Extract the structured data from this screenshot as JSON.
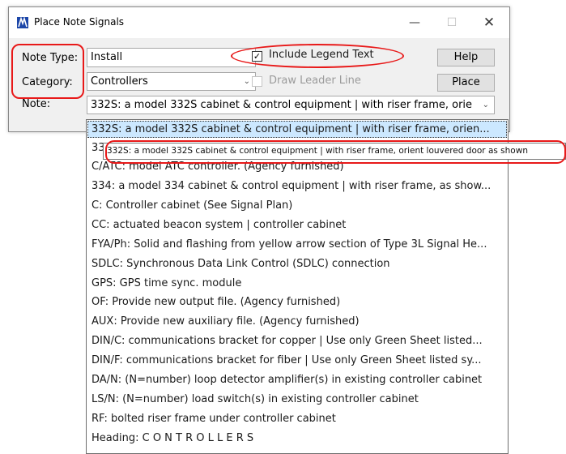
{
  "window": {
    "title": "Place Note Signals",
    "controls": {
      "minimize": "—",
      "maximize": "☐",
      "close": "✕"
    }
  },
  "form": {
    "note_type_label": "Note Type:",
    "note_type_value": "Install",
    "category_label": "Category:",
    "category_value": "Controllers",
    "note_label": "Note:",
    "note_value": "332S: a model 332S cabinet & control equipment | with riser frame, orie"
  },
  "options": {
    "include_legend_text": {
      "label": "Include Legend Text",
      "checked": true
    },
    "draw_leader_line": {
      "label": "Draw Leader Line",
      "checked": false,
      "enabled": false
    }
  },
  "buttons": {
    "help": "Help",
    "place": "Place"
  },
  "dropdown": {
    "items": [
      "332S: a model 332S cabinet & control equipment | with riser frame, orien...",
      "33",
      "C/ATC: model ATC controller. (Agency furnished)",
      "334: a model 334 cabinet & control equipment | with riser frame, as show...",
      "C: Controller cabinet (See Signal Plan)",
      "CC: actuated beacon system | controller cabinet",
      "FYA/Ph: Solid and flashing from yellow arrow section of Type 3L Signal He...",
      "SDLC: Synchronous Data Link Control (SDLC) connection",
      "GPS: GPS time sync. module",
      "OF: Provide new output file. (Agency furnished)",
      "AUX: Provide new auxiliary file. (Agency furnished)",
      "DIN/C: communications bracket for copper  | Use only Green Sheet listed...",
      "DIN/F: communications bracket for fiber  | Use only Green Sheet listed sy...",
      "DA/N: (N=number) loop detector amplifier(s) in existing controller cabinet",
      "LS/N: (N=number) load switch(s) in existing controller cabinet",
      "RF: bolted riser frame under controller cabinet",
      "Heading: C O N T R O L L E R S"
    ],
    "selected_index": 0
  },
  "tooltip": "332S: a model 332S cabinet & control equipment | with riser frame, orient louvered door as shown",
  "colors": {
    "highlight_ring": "#e81919",
    "selection": "#cce8ff",
    "app_icon": "#1c46a8"
  }
}
